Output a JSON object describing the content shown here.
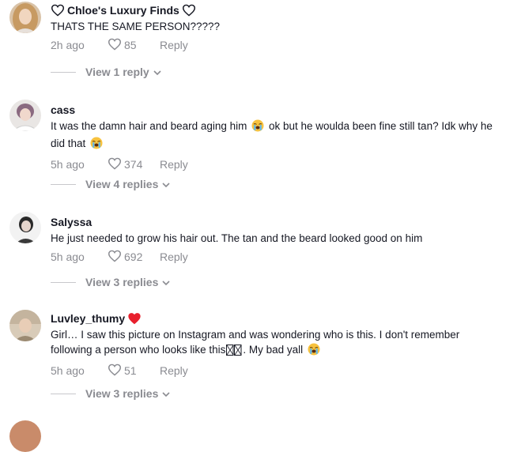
{
  "comments": [
    {
      "username": "Chloe's Luxury Finds",
      "text": "THATS THE SAME PERSON?????",
      "time": "2h ago",
      "likes": "85",
      "reply_label": "Reply",
      "view_replies": "View 1 reply"
    },
    {
      "username": "cass",
      "text_part1": "It was the damn hair and beard aging him",
      "text_part2": "ok but he woulda been fine still tan? Idk why he did that",
      "time": "5h ago",
      "likes": "374",
      "reply_label": "Reply",
      "view_replies": "View 4 replies"
    },
    {
      "username": "Salyssa",
      "text": "He just needed to grow his hair out. The tan and the beard looked good on him",
      "time": "5h ago",
      "likes": "692",
      "reply_label": "Reply",
      "view_replies": "View 3 replies"
    },
    {
      "username": "Luvley_thumy",
      "text_part1": "Girl… I saw this picture on Instagram and was wondering who is this. I don't remember following a person who looks like this",
      "text_part2": ". My bad yall",
      "time": "5h ago",
      "likes": "51",
      "reply_label": "Reply",
      "view_replies": "View 3 replies"
    }
  ],
  "icons": {
    "like": "heart-outline-icon",
    "crying_emoji": "loudly-crying-face-emoji",
    "red_heart": "red-heart-emoji",
    "chevron": "chevron-down-icon"
  },
  "colors": {
    "text": "#161823",
    "muted": "#8a8b91",
    "heart_red": "#e8202d"
  }
}
